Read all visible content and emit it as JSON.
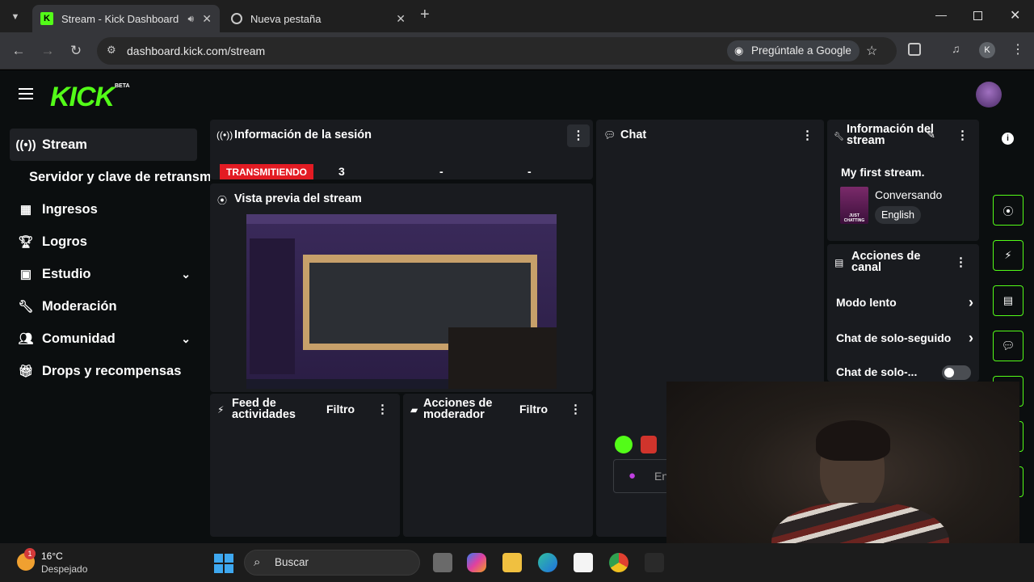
{
  "browser": {
    "tabs": [
      {
        "title": "Stream - Kick Dashboard",
        "icon": "kick-icon"
      },
      {
        "title": "Nueva pestaña",
        "icon": "chrome-icon"
      }
    ],
    "new_tab_symbol": "+",
    "url": "dashboard.kick.com/stream",
    "ask_google": "Pregúntale a Google",
    "profile_initial": "K"
  },
  "kick": {
    "logo": "KICK",
    "beta": "BETA",
    "accent": "#53fc18",
    "nav": [
      {
        "label": "Stream",
        "icon": "broadcast-icon",
        "active": true
      },
      {
        "label": "Servidor y clave de retransm",
        "icon": "",
        "active": false
      },
      {
        "label": "Ingresos",
        "icon": "revenue-icon",
        "active": false
      },
      {
        "label": "Logros",
        "icon": "trophy-icon",
        "active": false
      },
      {
        "label": "Estudio",
        "icon": "studio-icon",
        "active": false,
        "expandable": true
      },
      {
        "label": "Moderación",
        "icon": "wrench-icon",
        "active": false
      },
      {
        "label": "Comunidad",
        "icon": "community-icon",
        "active": false,
        "expandable": true
      },
      {
        "label": "Drops y recompensas",
        "icon": "gift-icon",
        "active": false
      }
    ],
    "session": {
      "title": "Información de la sesión",
      "status": "TRANSMITIENDO",
      "viewers": "3",
      "stat2": "-",
      "stat3": "-"
    },
    "preview": {
      "title": "Vista previa del stream"
    },
    "chat": {
      "title": "Chat",
      "input_placeholder": "En"
    },
    "stream_info": {
      "title": "Información del stream",
      "stream_title": "My first stream.",
      "category": "Conversando",
      "language": "English",
      "category_thumb": "JUST CHATTING"
    },
    "channel_actions": {
      "title": "Acciones de canal",
      "items": [
        {
          "label": "Modo lento"
        },
        {
          "label": "Chat de solo-seguido"
        },
        {
          "label": "Chat de solo-..."
        }
      ]
    },
    "activity_feed": {
      "title": "Feed de actividades",
      "filter": "Filtro"
    },
    "mod_actions": {
      "title": "Acciones de moderador",
      "filter": "Filtro"
    }
  },
  "taskbar": {
    "weather_temp": "16°C",
    "weather_desc": "Despejado",
    "weather_badge": "1",
    "search_placeholder": "Buscar"
  }
}
